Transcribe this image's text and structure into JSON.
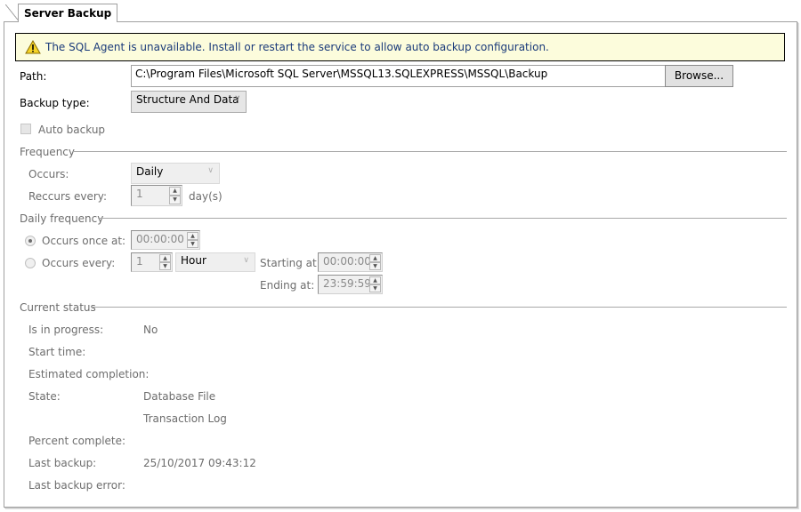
{
  "tab": {
    "label": "Server Backup"
  },
  "warning": {
    "icon": "warning-icon",
    "text": "The SQL Agent is unavailable. Install or restart the service to allow auto backup configuration."
  },
  "path": {
    "label": "Path:",
    "value": "C:\\Program Files\\Microsoft SQL Server\\MSSQL13.SQLEXPRESS\\MSSQL\\Backup",
    "browse_label": "Browse..."
  },
  "backup_type": {
    "label": "Backup type:",
    "selected": "Structure And Data"
  },
  "auto_backup": {
    "label": "Auto backup",
    "checked": false
  },
  "frequency": {
    "title": "Frequency",
    "occurs_label": "Occurs:",
    "occurs_value": "Daily",
    "recurs_label": "Reccurs every:",
    "recurs_value": "1",
    "recurs_unit": "day(s)"
  },
  "daily_frequency": {
    "title": "Daily frequency",
    "once_label": "Occurs once at:",
    "once_value": "00:00:00",
    "once_selected": true,
    "every_label": "Occurs every:",
    "every_value": "1",
    "every_unit": "Hour",
    "starting_label": "Starting at:",
    "starting_value": "00:00:00",
    "ending_label": "Ending at:",
    "ending_value": "23:59:59"
  },
  "current_status": {
    "title": "Current status",
    "rows": [
      {
        "label": "Is in progress:",
        "value": "No"
      },
      {
        "label": "Start time:",
        "value": ""
      },
      {
        "label": "Estimated completion:",
        "value": ""
      },
      {
        "label": "State:",
        "value": "Database File"
      },
      {
        "label": "",
        "value": "Transaction Log"
      },
      {
        "label": "Percent complete:",
        "value": ""
      },
      {
        "label": "Last backup:",
        "value": "25/10/2017 09:43:12"
      },
      {
        "label": "Last backup error:",
        "value": ""
      }
    ]
  }
}
